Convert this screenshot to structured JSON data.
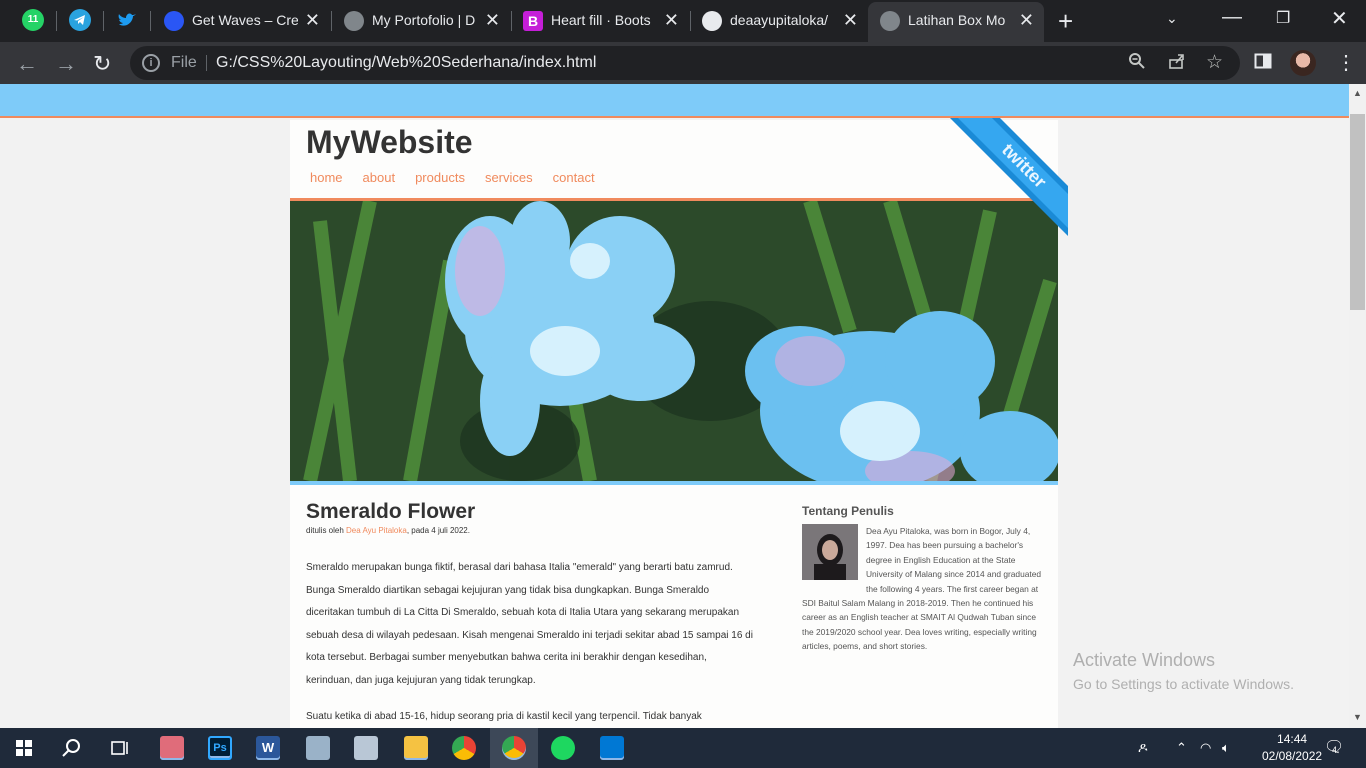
{
  "browser": {
    "pinned_tabs": [
      "whatsapp-badge-11",
      "telegram",
      "twitter"
    ],
    "whatsapp_badge": "11",
    "tabs": [
      {
        "title": "Get Waves – Cre",
        "icon": "waves-icon"
      },
      {
        "title": "My Portofolio | D",
        "icon": "globe-icon"
      },
      {
        "title": "Heart fill · Boots",
        "icon": "bootstrap-icon"
      },
      {
        "title": "deaayupitaloka/",
        "icon": "github-icon"
      },
      {
        "title": "Latihan Box Mo",
        "icon": "globe-icon",
        "active": true
      }
    ],
    "scheme_label": "File",
    "url": "G:/CSS%20Layouting/Web%20Sederhana/index.html"
  },
  "page": {
    "site_title": "MyWebsite",
    "nav": [
      "home",
      "about",
      "products",
      "services",
      "contact"
    ],
    "ribbon_text": "twitter",
    "article": {
      "title": "Smeraldo Flower",
      "byline_prefix": "ditulis oleh ",
      "byline_author": "Dea Ayu Pitaloka",
      "byline_suffix": ", pada 4 juli 2022.",
      "paragraph1": "Smeraldo merupakan bunga fiktif, berasal dari bahasa Italia \"emerald\" yang berarti batu zamrud. Bunga Smeraldo diartikan sebagai kejujuran yang tidak bisa dungkapkan. Bunga Smeraldo diceritakan tumbuh di La Citta Di Smeraldo, sebuah kota di Italia Utara yang sekarang merupakan sebuah desa di wilayah pedesaan. Kisah mengenai Smeraldo ini terjadi sekitar abad 15 sampai 16 di kota tersebut. Berbagai sumber menyebutkan bahwa cerita ini berakhir dengan kesedihan, kerinduan, dan juga kejujuran yang tidak terungkap.",
      "paragraph2": "Suatu ketika di abad 15-16, hidup seorang pria di kastil kecil yang terpencil. Tidak banyak"
    },
    "sidebar": {
      "title": "Tentang Penulis",
      "body": "Dea Ayu Pitaloka, was born in Bogor, July 4, 1997. Dea has been pursuing a bachelor's degree in English Education at the State University of Malang since 2014 and graduated the following 4 years. The first career began at SDI Baitul Salam Malang in 2018-2019. Then he continued his career as an English teacher at SMAIT Al Qudwah Tuban since the 2019/2020 school year. Dea loves writing, especially writing articles, poems, and short stories."
    },
    "colors": {
      "accent": "#f08a5d",
      "band": "#7ecbf9"
    }
  },
  "watermark": {
    "line1": "Activate Windows",
    "line2": "Go to Settings to activate Windows."
  },
  "taskbar": {
    "time": "14:44",
    "date": "02/08/2022",
    "notification_count": "4",
    "apps": [
      "paint-icon",
      "photoshop-icon",
      "word-icon",
      "network-icon",
      "photos-icon",
      "file-explorer-icon",
      "chrome-icon",
      "chrome-profile-icon",
      "spotify-icon",
      "vscode-icon"
    ]
  }
}
